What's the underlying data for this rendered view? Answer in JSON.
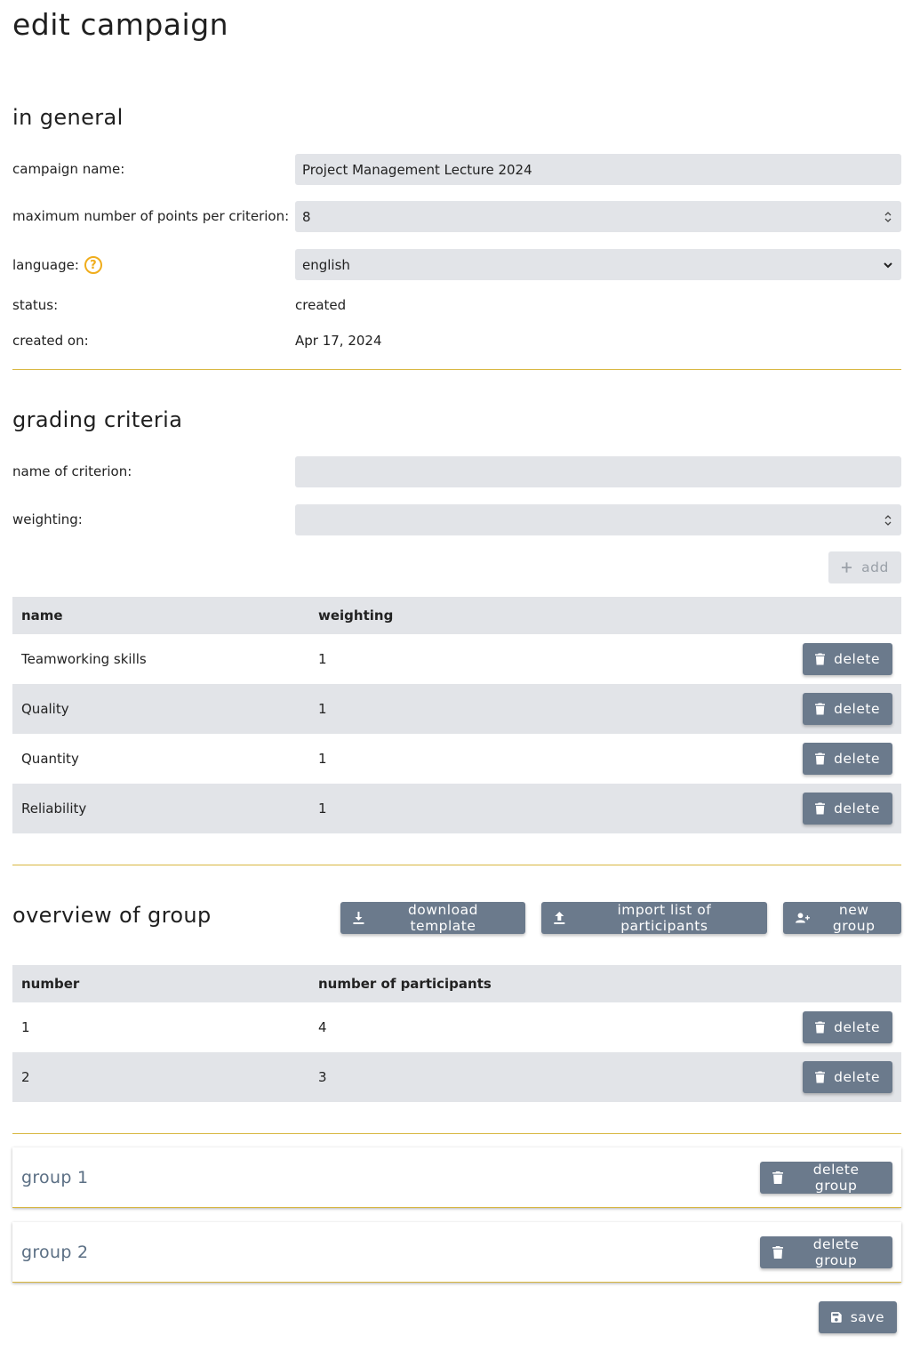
{
  "page_title": "edit campaign",
  "general": {
    "heading": "in general",
    "campaign_name_label": "campaign name:",
    "campaign_name_value": "Project Management Lecture 2024",
    "max_points_label": "maximum number of points per criterion:",
    "max_points_value": "8",
    "language_label": "language:",
    "language_value": "english",
    "status_label": "status:",
    "status_value": "created",
    "created_on_label": "created on:",
    "created_on_value": "Apr 17, 2024"
  },
  "criteria": {
    "heading": "grading criteria",
    "name_label": "name of criterion:",
    "name_value": "",
    "weighting_label": "weighting:",
    "weighting_value": "",
    "add_label": "add",
    "columns": [
      "name",
      "weighting"
    ],
    "rows": [
      {
        "name": "Teamworking skills",
        "weighting": "1"
      },
      {
        "name": "Quality",
        "weighting": "1"
      },
      {
        "name": "Quantity",
        "weighting": "1"
      },
      {
        "name": "Reliability",
        "weighting": "1"
      }
    ],
    "delete_label": "delete"
  },
  "groups": {
    "heading": "overview of group",
    "download_label": "download template",
    "import_label": "import list of participants",
    "new_group_label": "new group",
    "columns": [
      "number",
      "number of participants"
    ],
    "rows": [
      {
        "number": "1",
        "participants": "4"
      },
      {
        "number": "2",
        "participants": "3"
      }
    ],
    "delete_label": "delete",
    "cards": [
      {
        "title": "group 1",
        "delete_label": "delete group"
      },
      {
        "title": "group 2",
        "delete_label": "delete group"
      }
    ]
  },
  "save_label": "save",
  "colors": {
    "accent_line": "#d8b740",
    "button": "#6b7a8c",
    "field_bg": "#e2e4e8",
    "help_icon": "#f0ad1c"
  }
}
